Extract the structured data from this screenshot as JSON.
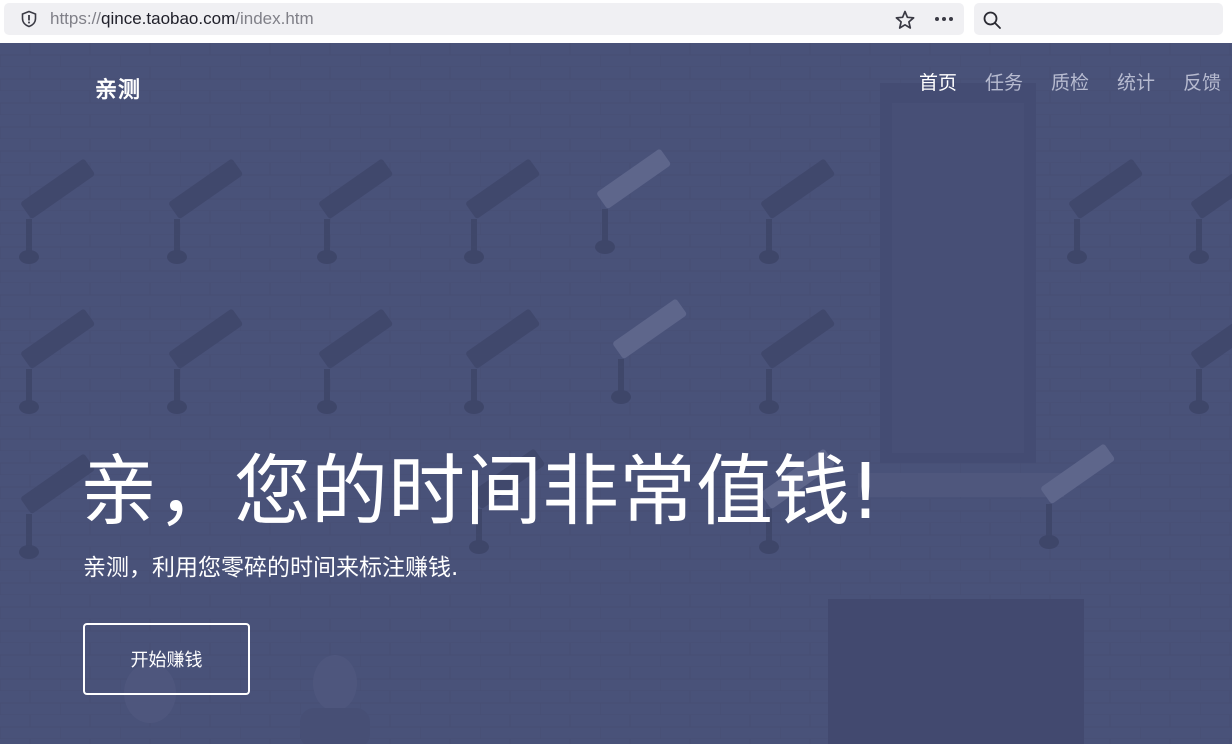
{
  "browser": {
    "url_scheme": "https://",
    "url_host": "qince.taobao.com",
    "url_path": "/index.htm",
    "search_value": ""
  },
  "site": {
    "brand": "亲测",
    "nav": [
      {
        "label": "首页",
        "active": true
      },
      {
        "label": "任务",
        "active": false
      },
      {
        "label": "质检",
        "active": false
      },
      {
        "label": "统计",
        "active": false
      },
      {
        "label": "反馈",
        "active": false
      }
    ]
  },
  "hero": {
    "headline": "亲，您的时间非常值钱!",
    "subline": "亲测，利用您零碎的时间来标注赚钱.",
    "cta_label": "开始赚钱"
  },
  "colors": {
    "hero_overlay": "#4a5279",
    "nav_active": "#ffffff",
    "nav_inactive": "#b7bbd0"
  },
  "icons": {
    "address_bar": "shield-icon",
    "bookmark": "star-icon",
    "menu": "more-dots-icon",
    "search": "search-icon"
  }
}
